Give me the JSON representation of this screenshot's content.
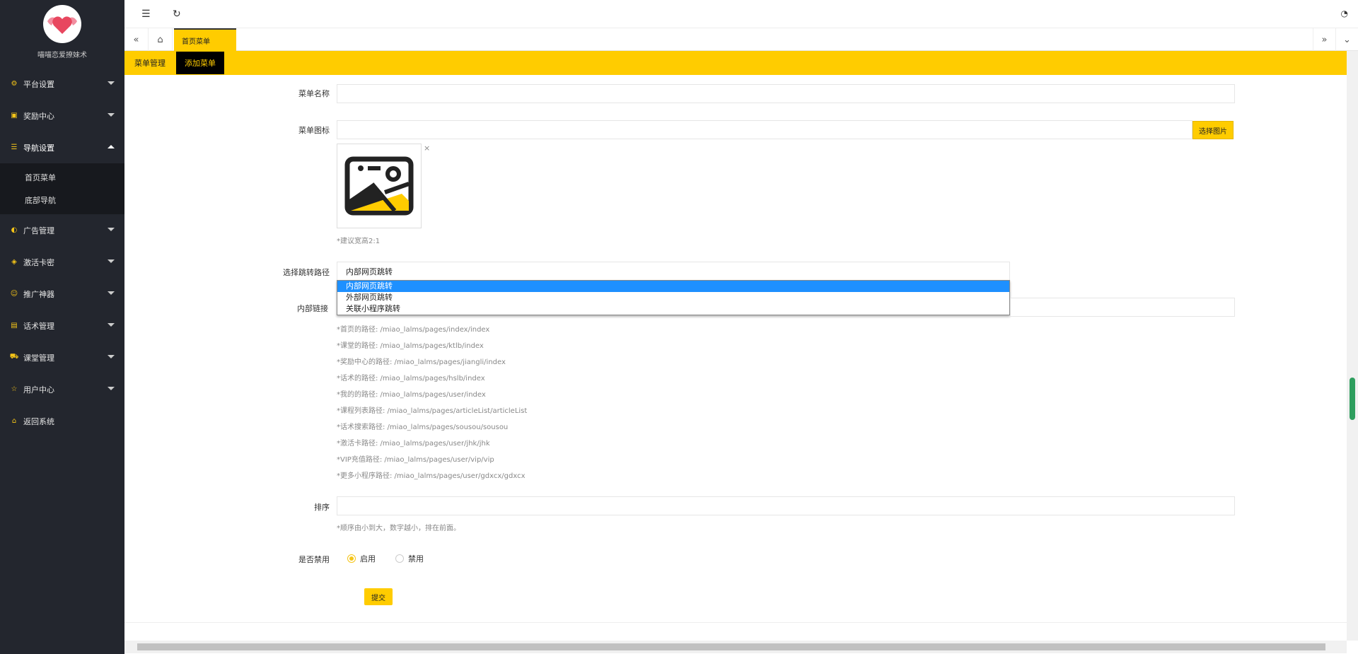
{
  "sidebar": {
    "brand": "喵喵恋爱撩妹术",
    "items": [
      {
        "label": "平台设置",
        "icon": "gear-icon"
      },
      {
        "label": "奖励中心",
        "icon": "play-icon"
      },
      {
        "label": "导航设置",
        "icon": "list-icon",
        "expanded": true
      },
      {
        "label": "广告管理",
        "icon": "palette-icon"
      },
      {
        "label": "激活卡密",
        "icon": "cube-icon"
      },
      {
        "label": "推广神器",
        "icon": "smile-icon"
      },
      {
        "label": "话术管理",
        "icon": "doc-icon"
      },
      {
        "label": "课堂管理",
        "icon": "car-icon"
      },
      {
        "label": "用户中心",
        "icon": "star-icon"
      },
      {
        "label": "返回系统",
        "icon": "home-icon"
      }
    ],
    "subitems": [
      {
        "label": "首页菜单"
      },
      {
        "label": "底部导航"
      }
    ]
  },
  "tabs": {
    "active": "首页菜单"
  },
  "subtabs": [
    {
      "label": "菜单管理"
    },
    {
      "label": "添加菜单"
    }
  ],
  "form": {
    "name_label": "菜单名称",
    "name_value": "",
    "icon_label": "菜单图标",
    "pick_button": "选择图片",
    "icon_hint": "*建议宽高2:1",
    "path_label": "选择跳转路径",
    "path_selected": "内部网页跳转",
    "path_options": [
      "内部网页跳转",
      "外部网页跳转",
      "关联小程序跳转"
    ],
    "link_label": "内部链接",
    "link_hints": [
      "*首页的路径:   /miao_lalms/pages/index/index",
      "*课堂的路径:   /miao_lalms/pages/ktlb/index",
      "*奖励中心的路径:   /miao_lalms/pages/jiangli/index",
      "*话术的路径:   /miao_lalms/pages/hslb/index",
      "*我的的路径:   /miao_lalms/pages/user/index",
      "*课程列表路径:   /miao_lalms/pages/articleList/articleList",
      "*话术搜索路径:   /miao_lalms/pages/sousou/sousou",
      "*激活卡路径:   /miao_lalms/pages/user/jhk/jhk",
      "*VIP充值路径:   /miao_lalms/pages/user/vip/vip",
      "*更多小程序路径:   /miao_lalms/pages/user/gdxcx/gdxcx"
    ],
    "sort_label": "排序",
    "sort_hint": "*顺序由小到大，数字越小，排在前面。",
    "status_label": "是否禁用",
    "status_on": "启用",
    "status_off": "禁用",
    "submit": "提交"
  },
  "colors": {
    "accent": "#ffcc00",
    "sidebar_bg": "#23262e",
    "dropdown_selected": "#1e90ff"
  }
}
